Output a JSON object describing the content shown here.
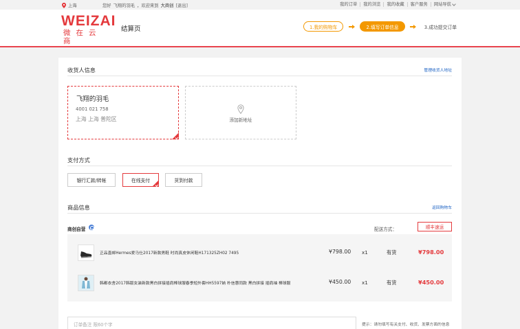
{
  "topbar": {
    "location": "上海",
    "greeting_prefix": "您好",
    "username": "飞翔的羽毛",
    "greeting_mid": "，欢迎来到",
    "brand": "大商创",
    "logout": "[退出]",
    "links": [
      "我的订单",
      "我的浏览",
      "我的收藏",
      "客户服务",
      "网站导航"
    ]
  },
  "header": {
    "logo_main": "WEIZAI",
    "logo_sub": "微在云商",
    "page_title": "结算页",
    "steps": [
      "1.我的购物车",
      "2.填写订单信息",
      "3.成功提交订单"
    ]
  },
  "receiver": {
    "title": "收货人信息",
    "manage_link": "管理收货人地址",
    "selected": {
      "name": "飞翔的羽毛",
      "phone": "4001 021 758",
      "region": "上海 上海 普陀区"
    },
    "add_label": "添加新地址"
  },
  "payment": {
    "title": "支付方式",
    "options": [
      "银行汇款/转帐",
      "在线支付",
      "货到付款"
    ],
    "selected_index": 1
  },
  "goods": {
    "title": "商品信息",
    "back_link": "返回购物车",
    "shop_name": "商创自营",
    "ship_label": "配送方式：",
    "ship_option": "顺丰速运",
    "items": [
      {
        "name": "正品直邮Hermes爱马仕2017新款男鞋 时尚真皮休闲鞋H171325ZH02 7495",
        "price": "¥798.00",
        "qty": "x1",
        "stock": "有货",
        "total": "¥798.00",
        "icon": "shoe-icon"
      },
      {
        "name": "韩都衣舍2017韩版女装新款黑白拼接插肩棒球服春季短外套HH5597妠 朴信惠同款 黑白拼接 插肩袖 棒球服",
        "price": "¥450.00",
        "qty": "x1",
        "stock": "有货",
        "total": "¥450.00",
        "icon": "jacket-icon"
      }
    ]
  },
  "remark": {
    "placeholder": "订单备注 限60个字",
    "hint": "提示：请勿填写有关支付、收货、发票方面的信息"
  },
  "colors": {
    "accent": "#e4393c",
    "step": "#f39800",
    "link": "#1e63c4"
  }
}
